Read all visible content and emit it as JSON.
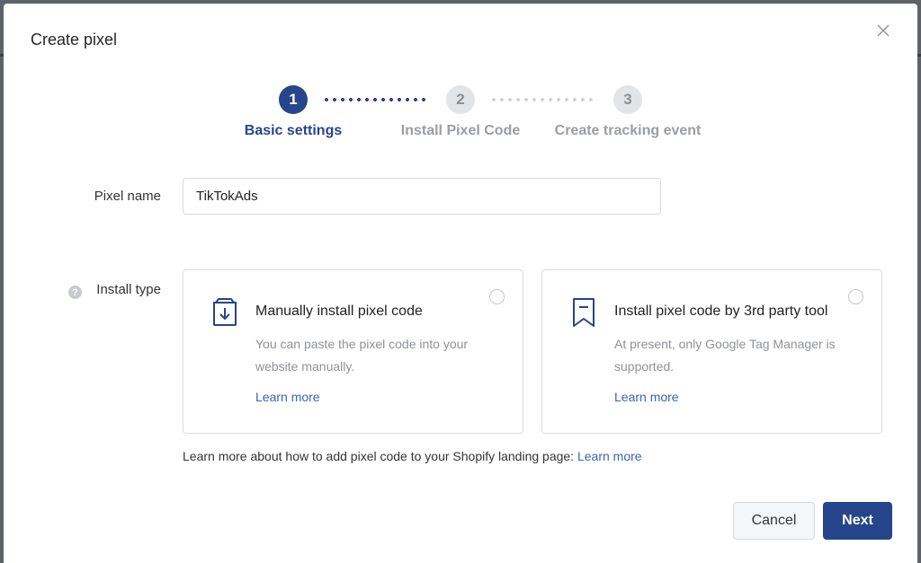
{
  "dialog": {
    "title": "Create pixel",
    "close_icon": "close-icon"
  },
  "stepper": {
    "steps": [
      {
        "number": "1",
        "label": "Basic settings",
        "state": "active"
      },
      {
        "number": "2",
        "label": "Install Pixel Code",
        "state": "inactive"
      },
      {
        "number": "3",
        "label": "Create tracking event",
        "state": "inactive"
      }
    ]
  },
  "form": {
    "pixel_name_label": "Pixel name",
    "pixel_name_value": "TikTokAds",
    "install_type_label": "Install type",
    "help_icon": "?"
  },
  "install_options": [
    {
      "icon": "download-box-icon",
      "title": "Manually install pixel code",
      "description": "You can paste the pixel code into your website manually.",
      "link": "Learn more",
      "selected": false
    },
    {
      "icon": "bookmark-icon",
      "title": "Install pixel code by 3rd party tool",
      "description": "At present, only Google Tag Manager is supported.",
      "link": "Learn more",
      "selected": false
    }
  ],
  "footnote": {
    "text": "Learn more about how to add pixel code to your Shopify landing page:",
    "link": "Learn more"
  },
  "buttons": {
    "cancel": "Cancel",
    "next": "Next"
  },
  "colors": {
    "primary": "#26458a",
    "link": "#3a64b3",
    "inactive_step": "#e3e4e6"
  }
}
